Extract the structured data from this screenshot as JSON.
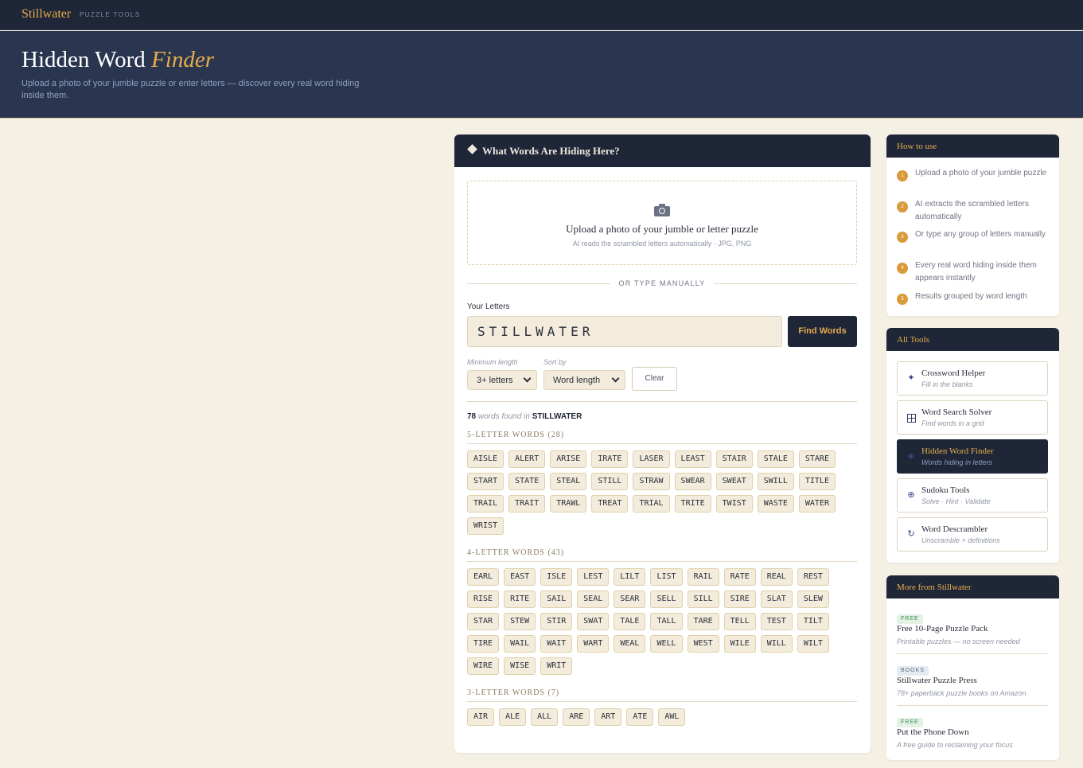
{
  "brand": {
    "name": "Stillwater",
    "sub": "PUZZLE TOOLS"
  },
  "hero": {
    "title_main": "Hidden Word ",
    "title_accent": "Finder",
    "description": "Upload a photo of your jumble puzzle or enter letters — discover every real word hiding inside them."
  },
  "card": {
    "title": "What Words Are Hiding Here?",
    "upload": {
      "title": "Upload a photo of your jumble or letter puzzle",
      "hint": "AI reads the scrambled letters automatically · JPG, PNG",
      "icon": "camera-icon"
    },
    "divider": "OR TYPE MANUALLY",
    "letters_label": "Your Letters",
    "letters_value": "STILLWATER",
    "find_label": "Find Words",
    "min_label": "Minimum length",
    "min_value": "3+ letters",
    "sort_label": "Sort by",
    "sort_value": "Word length",
    "clear_label": "Clear",
    "summary": {
      "count": "78",
      "mid": " words found in ",
      "source": "STILLWATER"
    }
  },
  "groups": [
    {
      "heading": "5-LETTER WORDS (28)",
      "words": [
        "AISLE",
        "ALERT",
        "ARISE",
        "IRATE",
        "LASER",
        "LEAST",
        "STAIR",
        "STALE",
        "STARE",
        "START",
        "STATE",
        "STEAL",
        "STILL",
        "STRAW",
        "SWEAR",
        "SWEAT",
        "SWILL",
        "TITLE",
        "TRAIL",
        "TRAIT",
        "TRAWL",
        "TREAT",
        "TRIAL",
        "TRITE",
        "TWIST",
        "WASTE",
        "WATER",
        "WRIST"
      ]
    },
    {
      "heading": "4-LETTER WORDS (43)",
      "words": [
        "EARL",
        "EAST",
        "ISLE",
        "LEST",
        "LILT",
        "LIST",
        "RAIL",
        "RATE",
        "REAL",
        "REST",
        "RISE",
        "RITE",
        "SAIL",
        "SEAL",
        "SEAR",
        "SELL",
        "SILL",
        "SIRE",
        "SLAT",
        "SLEW",
        "STAR",
        "STEW",
        "STIR",
        "SWAT",
        "TALE",
        "TALL",
        "TARE",
        "TELL",
        "TEST",
        "TILT",
        "TIRE",
        "WAIL",
        "WAIT",
        "WART",
        "WEAL",
        "WELL",
        "WEST",
        "WILE",
        "WILL",
        "WILT",
        "WIRE",
        "WISE",
        "WRIT"
      ]
    },
    {
      "heading": "3-LETTER WORDS (7)",
      "words": [
        "AIR",
        "ALE",
        "ALL",
        "ARE",
        "ART",
        "ATE",
        "AWL"
      ]
    }
  ],
  "howto": {
    "title": "How to use",
    "steps": [
      {
        "num": "1",
        "text": "Upload a photo of your jumble puzzle"
      },
      {
        "num": "2",
        "text": "AI extracts the scrambled letters automatically"
      },
      {
        "num": "3",
        "text": "Or type any group of letters manually"
      },
      {
        "num": "4",
        "text": "Every real word hiding inside them appears instantly"
      },
      {
        "num": "5",
        "text": "Results grouped by word length"
      }
    ]
  },
  "tools": {
    "title": "All Tools",
    "items": [
      {
        "name": "Crossword Helper",
        "desc": "Fill in the blanks",
        "icon": "sparkle-icon"
      },
      {
        "name": "Word Search Solver",
        "desc": "Find words in a grid",
        "icon": "grid-icon"
      },
      {
        "name": "Hidden Word Finder",
        "desc": "Words hiding in letters",
        "icon": "diamond-icon"
      },
      {
        "name": "Sudoku Tools",
        "desc": "Solve · Hint · Validate",
        "icon": "circle-plus-icon"
      },
      {
        "name": "Word Descrambler",
        "desc": "Unscramble + definitions",
        "icon": "refresh-icon"
      }
    ]
  },
  "more": {
    "title": "More from Stillwater",
    "items": [
      {
        "badge": "FREE",
        "title": "Free 10-Page Puzzle Pack",
        "desc": "Printable puzzles — no screen needed"
      },
      {
        "badge": "BOOKS",
        "title": "Stillwater Puzzle Press",
        "desc": "78+ paperback puzzle books on Amazon"
      },
      {
        "badge": "FREE",
        "title": "Put the Phone Down",
        "desc": "A free guide to reclaiming your focus"
      }
    ]
  },
  "colors": {
    "navy": "#1e2638",
    "gold": "#e8ad4a",
    "cream": "#f5f0e4"
  }
}
